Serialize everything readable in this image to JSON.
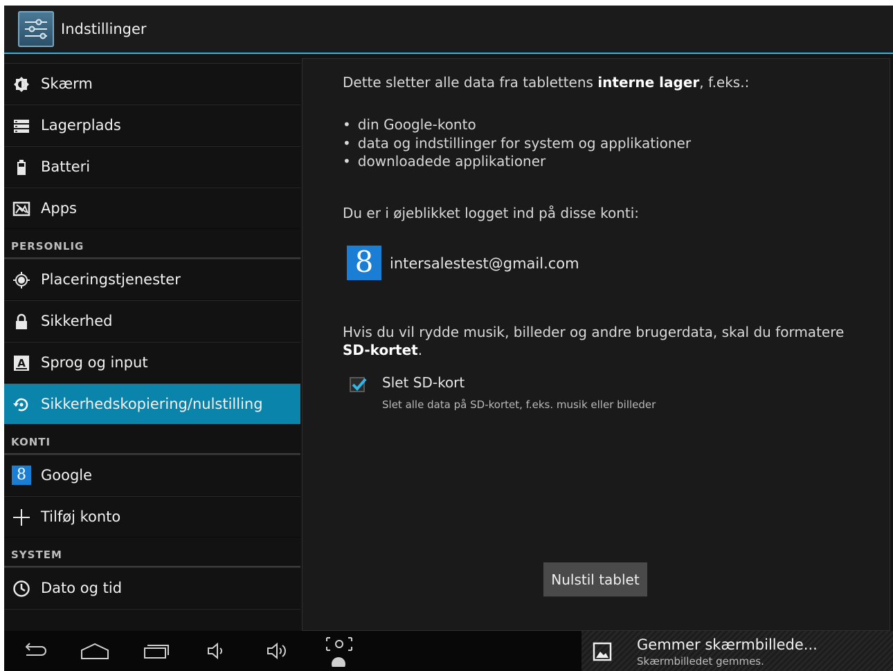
{
  "app": {
    "title": "Indstillinger"
  },
  "sidebar": {
    "items": [
      {
        "label": "Skærm",
        "icon": "brightness-icon"
      },
      {
        "label": "Lagerplads",
        "icon": "storage-icon"
      },
      {
        "label": "Batteri",
        "icon": "battery-icon"
      },
      {
        "label": "Apps",
        "icon": "apps-icon"
      }
    ],
    "personal_header": "PERSONLIG",
    "personal_items": [
      {
        "label": "Placeringstjenester",
        "icon": "location-icon"
      },
      {
        "label": "Sikkerhed",
        "icon": "lock-icon"
      },
      {
        "label": "Sprog og input",
        "icon": "language-icon"
      },
      {
        "label": "Sikkerhedskopiering/nulstilling",
        "icon": "backup-icon",
        "active": true
      }
    ],
    "accounts_header": "KONTI",
    "account_items": [
      {
        "label": "Google",
        "icon": "google-icon"
      },
      {
        "label": "Tilføj konto",
        "icon": "plus-icon"
      }
    ],
    "system_header": "SYSTEM",
    "system_items": [
      {
        "label": "Dato og tid",
        "icon": "clock-icon"
      }
    ]
  },
  "panel": {
    "intro_prefix": "Dette sletter alle data fra tablettens ",
    "intro_bold": "interne lager",
    "intro_suffix": ", f.eks.:",
    "bullets": [
      "din Google-konto",
      "data og indstillinger for system og applikationer",
      "downloadede applikationer"
    ],
    "accounts_text": "Du er i øjeblikket logget ind på disse konti:",
    "account_logo": "8",
    "account_email": "intersalestest@gmail.com",
    "sd_text_line1": "Hvis du vil rydde musik, billeder og andre brugerdata, skal du formatere",
    "sd_text_bold": "SD-kortet",
    "sd_text_end": ".",
    "checkbox_checked": true,
    "checkbox_title": "Slet SD-kort",
    "checkbox_subtitle": "Slet alle data på SD-kortet, f.eks. musik eller billeder",
    "reset_button": "Nulstil tablet"
  },
  "notification": {
    "title": "Gemmer skærmbillede...",
    "subtitle": "Skærmbilledet gemmes."
  },
  "colors": {
    "accent": "#33b5e5",
    "selected": "#0b84ab"
  }
}
